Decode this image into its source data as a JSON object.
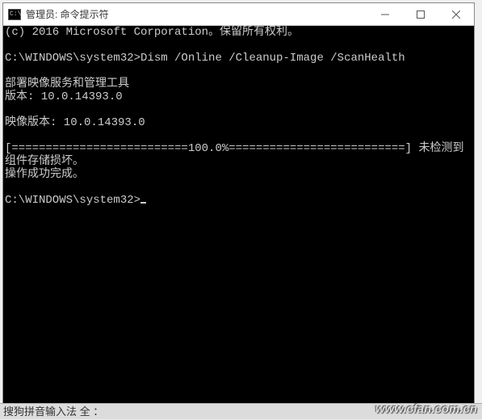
{
  "titlebar": {
    "icon_text": "C:\\",
    "title": "管理员: 命令提示符"
  },
  "console": {
    "lines": [
      "(c) 2016 Microsoft Corporation。保留所有权利。",
      "",
      "C:\\WINDOWS\\system32>Dism /Online /Cleanup-Image /ScanHealth",
      "",
      "部署映像服务和管理工具",
      "版本: 10.0.14393.0",
      "",
      "映像版本: 10.0.14393.0",
      "",
      "[==========================100.0%==========================] 未检测到组件存储损坏。",
      "操作成功完成。",
      "",
      "C:\\WINDOWS\\system32>"
    ]
  },
  "ime": {
    "text": "搜狗拼音输入法 全 ："
  },
  "watermark": {
    "text": "www.cfan.com.cn"
  }
}
